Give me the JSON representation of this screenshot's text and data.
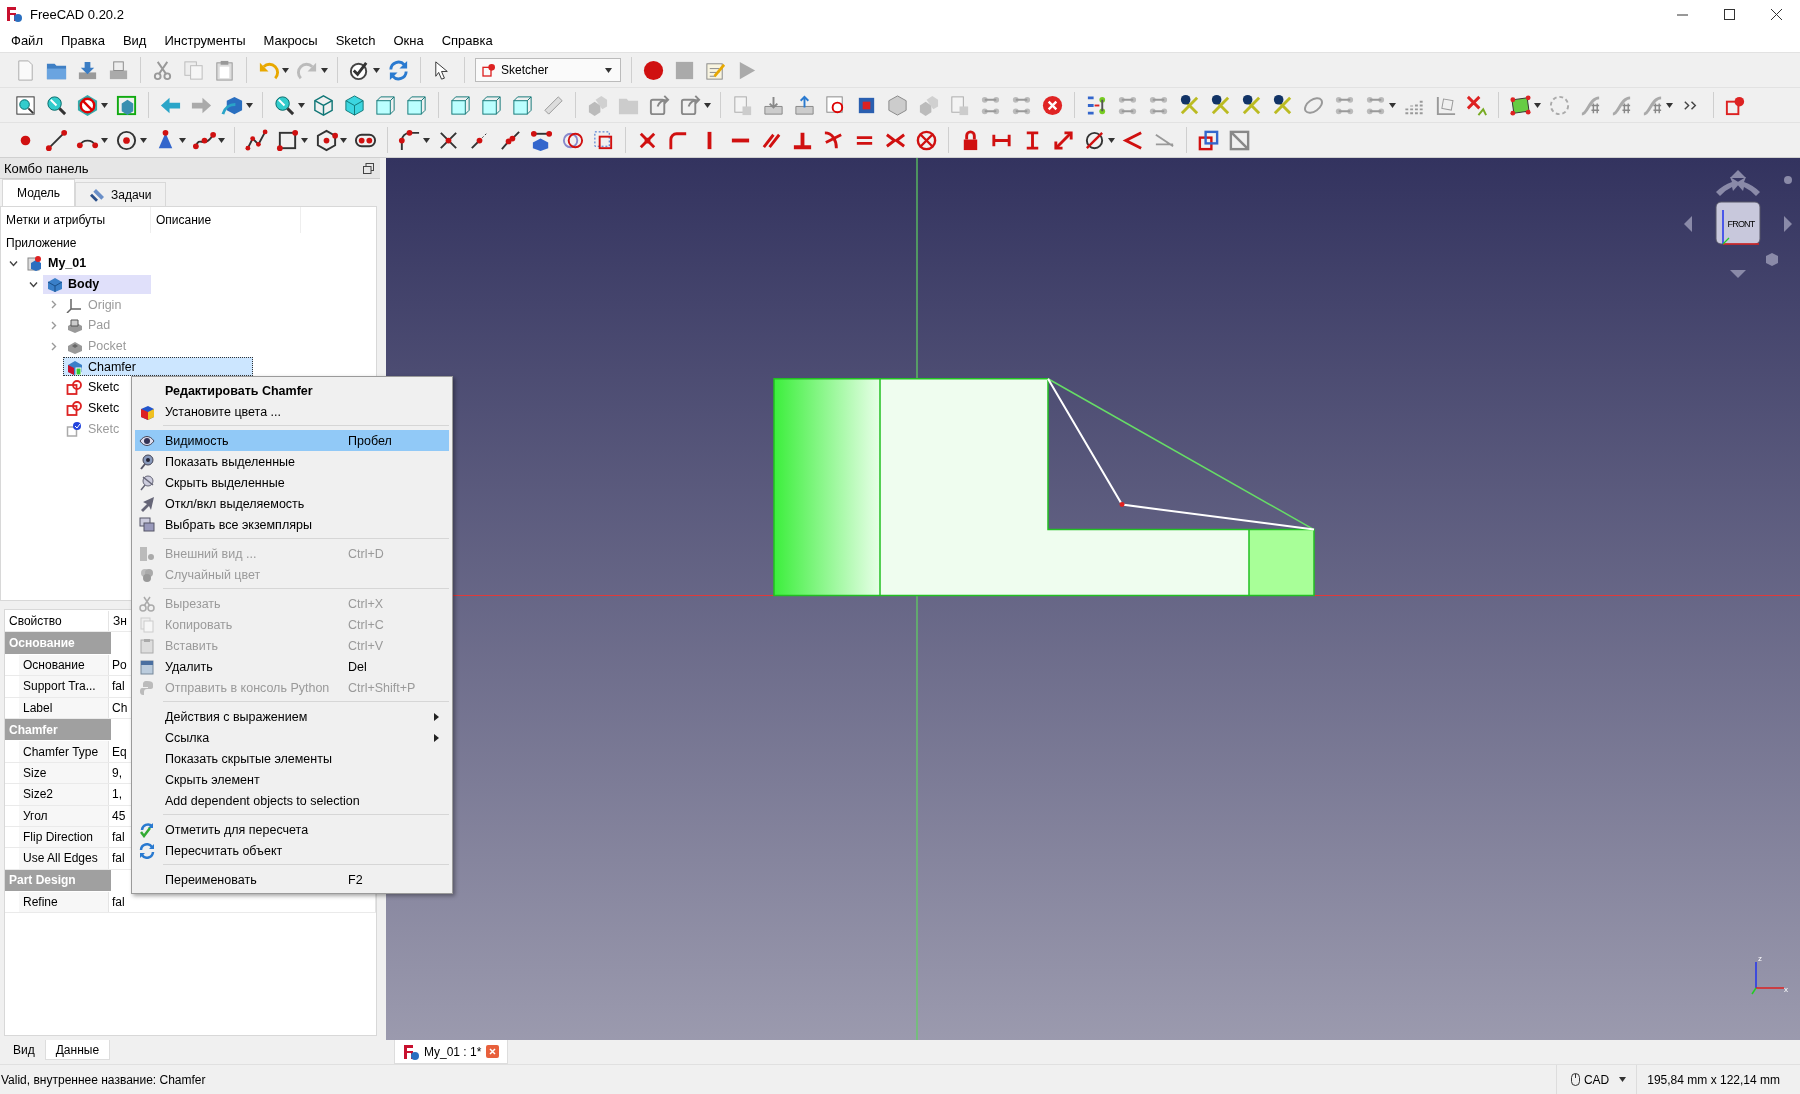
{
  "window": {
    "title": "FreeCAD 0.20.2"
  },
  "menu_bar": [
    "Файл",
    "Правка",
    "Вид",
    "Инструменты",
    "Макросы",
    "Sketch",
    "Окна",
    "Справка"
  ],
  "toolbar": {
    "workbench": "Sketcher"
  },
  "combo_panel": {
    "title": "Комбо панель",
    "tabs": [
      {
        "label": "Модель",
        "selected": true
      },
      {
        "label": "Задачи",
        "selected": false
      }
    ],
    "tree": {
      "columns": [
        "Метки и атрибуты",
        "Описание"
      ],
      "root_label": "Приложение",
      "items": [
        {
          "label": "My_01",
          "kind": "document",
          "bold": true,
          "active": false,
          "selected": false,
          "visible": true,
          "expanded": true,
          "children": [
            {
              "label": "Body",
              "kind": "body",
              "bold": true,
              "active": true,
              "selected": false,
              "visible": true,
              "expanded": true,
              "children": [
                {
                  "label": "Origin",
                  "kind": "origin",
                  "bold": false,
                  "active": false,
                  "selected": false,
                  "visible": false,
                  "expanded": false
                },
                {
                  "label": "Pad",
                  "kind": "pad",
                  "bold": false,
                  "active": false,
                  "selected": false,
                  "visible": false,
                  "expanded": false
                },
                {
                  "label": "Pocket",
                  "kind": "pocket",
                  "bold": false,
                  "active": false,
                  "selected": false,
                  "visible": false,
                  "expanded": false
                },
                {
                  "label": "Chamfer",
                  "kind": "chamfer",
                  "bold": false,
                  "active": false,
                  "selected": true,
                  "visible": true
                },
                {
                  "label": "Sketc",
                  "kind": "sketch",
                  "bold": false,
                  "active": false,
                  "selected": false,
                  "visible": true
                },
                {
                  "label": "Sketc",
                  "kind": "sketch",
                  "bold": false,
                  "active": false,
                  "selected": false,
                  "visible": true
                },
                {
                  "label": "Sketc",
                  "kind": "attached-sketch",
                  "bold": false,
                  "active": false,
                  "selected": false,
                  "visible": false
                }
              ]
            }
          ]
        }
      ]
    }
  },
  "properties": {
    "columns": [
      "Свойство",
      "Зн"
    ],
    "groups": [
      {
        "name": "Основание",
        "rows": [
          {
            "name": "Основание",
            "value": "Po"
          },
          {
            "name": "Support Tra...",
            "value": "fal"
          },
          {
            "name": "Label",
            "value": "Ch"
          }
        ]
      },
      {
        "name": "Chamfer",
        "rows": [
          {
            "name": "Chamfer Type",
            "value": "Eq"
          },
          {
            "name": "Size",
            "value": "9,"
          },
          {
            "name": "Size2",
            "value": "1,"
          },
          {
            "name": "Угол",
            "value": "45"
          },
          {
            "name": "Flip Direction",
            "value": "fal"
          },
          {
            "name": "Use All Edges",
            "value": "fal"
          }
        ]
      },
      {
        "name": "Part Design",
        "rows": [
          {
            "name": "Refine",
            "value": "fal"
          }
        ]
      }
    ]
  },
  "panel_tabs": [
    {
      "label": "Вид",
      "selected": false
    },
    {
      "label": "Данные",
      "selected": true
    }
  ],
  "context_menu": {
    "items": [
      {
        "kind": "item",
        "label": "Редактировать Chamfer",
        "bold": true,
        "disabled": false,
        "selected": false,
        "submenu": false
      },
      {
        "kind": "item",
        "label": "Установите цвета ...",
        "bold": false,
        "disabled": false,
        "selected": false,
        "submenu": false
      },
      {
        "kind": "separator"
      },
      {
        "kind": "item",
        "label": "Видимость",
        "shortcut": "Пробел",
        "bold": false,
        "disabled": false,
        "selected": true,
        "submenu": false
      },
      {
        "kind": "item",
        "label": "Показать выделенные",
        "bold": false,
        "disabled": false,
        "selected": false,
        "submenu": false
      },
      {
        "kind": "item",
        "label": "Скрыть выделенные",
        "bold": false,
        "disabled": false,
        "selected": false,
        "submenu": false
      },
      {
        "kind": "item",
        "label": "Откл/вкл выделяемость",
        "bold": false,
        "disabled": false,
        "selected": false,
        "submenu": false
      },
      {
        "kind": "item",
        "label": "Выбрать все экземпляры",
        "bold": false,
        "disabled": false,
        "selected": false,
        "submenu": false
      },
      {
        "kind": "separator"
      },
      {
        "kind": "item",
        "label": "Внешний вид ...",
        "shortcut": "Ctrl+D",
        "bold": false,
        "disabled": true,
        "selected": false,
        "submenu": false
      },
      {
        "kind": "item",
        "label": "Случайный цвет",
        "bold": false,
        "disabled": true,
        "selected": false,
        "submenu": false
      },
      {
        "kind": "separator"
      },
      {
        "kind": "item",
        "label": "Вырезать",
        "shortcut": "Ctrl+X",
        "bold": false,
        "disabled": true,
        "selected": false,
        "submenu": false
      },
      {
        "kind": "item",
        "label": "Копировать",
        "shortcut": "Ctrl+C",
        "bold": false,
        "disabled": true,
        "selected": false,
        "submenu": false
      },
      {
        "kind": "item",
        "label": "Вставить",
        "shortcut": "Ctrl+V",
        "bold": false,
        "disabled": true,
        "selected": false,
        "submenu": false
      },
      {
        "kind": "item",
        "label": "Удалить",
        "shortcut": "Del",
        "bold": false,
        "disabled": false,
        "selected": false,
        "submenu": false
      },
      {
        "kind": "item",
        "label": "Отправить в консоль Python",
        "shortcut": "Ctrl+Shift+P",
        "bold": false,
        "disabled": true,
        "selected": false,
        "submenu": false
      },
      {
        "kind": "separator"
      },
      {
        "kind": "item",
        "label": "Действия с выражением",
        "bold": false,
        "disabled": false,
        "selected": false,
        "submenu": true
      },
      {
        "kind": "item",
        "label": "Ссылка",
        "bold": false,
        "disabled": false,
        "selected": false,
        "submenu": true
      },
      {
        "kind": "item",
        "label": "Показать скрытые элементы",
        "bold": false,
        "disabled": false,
        "selected": false,
        "submenu": false
      },
      {
        "kind": "item",
        "label": "Скрыть элемент",
        "bold": false,
        "disabled": false,
        "selected": false,
        "submenu": false
      },
      {
        "kind": "item",
        "label": "Add dependent objects to selection",
        "bold": false,
        "disabled": false,
        "selected": false,
        "submenu": false
      },
      {
        "kind": "separator"
      },
      {
        "kind": "item",
        "label": "Отметить для пересчета",
        "bold": false,
        "disabled": false,
        "selected": false,
        "submenu": false
      },
      {
        "kind": "item",
        "label": "Пересчитать объект",
        "bold": false,
        "disabled": false,
        "selected": false,
        "submenu": false
      },
      {
        "kind": "separator"
      },
      {
        "kind": "item",
        "label": "Переименовать",
        "shortcut": "F2",
        "bold": false,
        "disabled": false,
        "selected": false,
        "submenu": false
      }
    ]
  },
  "viewport": {
    "navigation_cube": {
      "face_label": "FRONT"
    },
    "axis_triad": {
      "labels": [
        "z",
        "x"
      ]
    }
  },
  "document_tabs": [
    {
      "label": "My_01 : 1*",
      "selected": true
    }
  ],
  "status_bar": {
    "message": "Valid, внутреннее название: Chamfer",
    "navigation_style": "CAD",
    "dimensions": "195,84 mm x 122,14 mm"
  }
}
